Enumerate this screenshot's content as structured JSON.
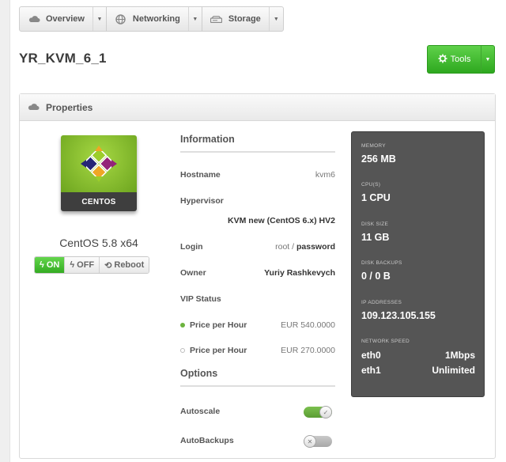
{
  "nav": {
    "items": [
      {
        "label": "Overview",
        "icon": "cloud-icon"
      },
      {
        "label": "Networking",
        "icon": "globe-icon"
      },
      {
        "label": "Storage",
        "icon": "hdd-icon"
      }
    ]
  },
  "vm": {
    "title": "YR_KVM_6_1",
    "tools_label": "Tools"
  },
  "properties": {
    "title": "Properties",
    "os_badge": "CENTOS",
    "os_name": "CentOS 5.8 x64",
    "power": {
      "on": "ON",
      "off": "OFF",
      "reboot": "Reboot"
    }
  },
  "information": {
    "title": "Information",
    "hostname_label": "Hostname",
    "hostname_value": "kvm6",
    "hypervisor_label": "Hypervisor",
    "hypervisor_value": "KVM new (CentOS 6.x) HV2",
    "login_label": "Login",
    "login_user": "root",
    "login_sep": "/",
    "login_pass": "password",
    "owner_label": "Owner",
    "owner_value": "Yuriy Rashkevych",
    "vip_label": "VIP Status",
    "price1_label": "Price per Hour",
    "price1_value": "EUR 540.0000",
    "price2_label": "Price per Hour",
    "price2_value": "EUR 270.0000"
  },
  "options": {
    "title": "Options",
    "autoscale_label": "Autoscale",
    "autoscale_on": true,
    "autobackups_label": "AutoBackups",
    "autobackups_on": false
  },
  "specs": {
    "memory_label": "MEMORY",
    "memory_value": "256 MB",
    "cpu_label": "CPU(S)",
    "cpu_value": "1 CPU",
    "disk_label": "DISK SIZE",
    "disk_value": "11 GB",
    "backups_label": "DISK BACKUPS",
    "backups_value": "0 / 0 B",
    "ip_label": "IP ADDRESSES",
    "ip_value": "109.123.105.155",
    "net_label": "NETWORK SPEED",
    "net": [
      {
        "iface": "eth0",
        "speed": "1Mbps"
      },
      {
        "iface": "eth1",
        "speed": "Unlimited"
      }
    ]
  },
  "colors": {
    "accent_green": "#34ac22",
    "spec_bg": "#555555",
    "price_active_dot": "#6cb33f",
    "price_inactive_dot": "#c8c8c8"
  }
}
